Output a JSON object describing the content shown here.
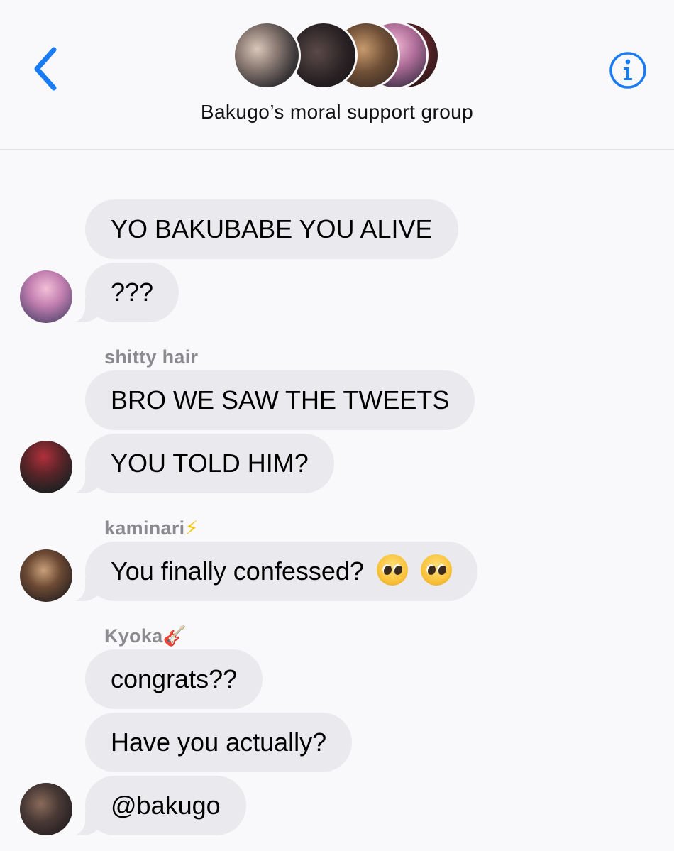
{
  "header": {
    "title": "Bakugo’s moral support group",
    "back_icon": "chevron-left-icon",
    "info_icon": "info-circle-icon",
    "accent_color": "#1a7cf5",
    "group_avatars": [
      "avatar-1",
      "avatar-2",
      "avatar-3",
      "avatar-4",
      "avatar-5"
    ]
  },
  "messages": [
    {
      "text": "YO BAKUBABE YOU ALIVE"
    },
    {
      "text": "???"
    },
    {
      "sender": "shitty hair",
      "text": "BRO WE SAW THE TWEETS"
    },
    {
      "text": "YOU TOLD HIM?"
    },
    {
      "sender": "kaminari",
      "sender_emoji": "⚡",
      "text": "You finally confessed?",
      "emoji": [
        "pleading-face-emoji",
        "pleading-face-emoji"
      ]
    },
    {
      "sender": "Kyoka",
      "sender_emoji": "🎸",
      "text": "congrats??"
    },
    {
      "text": "Have you actually?"
    },
    {
      "text": "@bakugo"
    }
  ],
  "colors": {
    "bubble_bg": "#e9e9ee",
    "page_bg": "#f9f9fb",
    "sender_text": "#8a8a8f"
  }
}
